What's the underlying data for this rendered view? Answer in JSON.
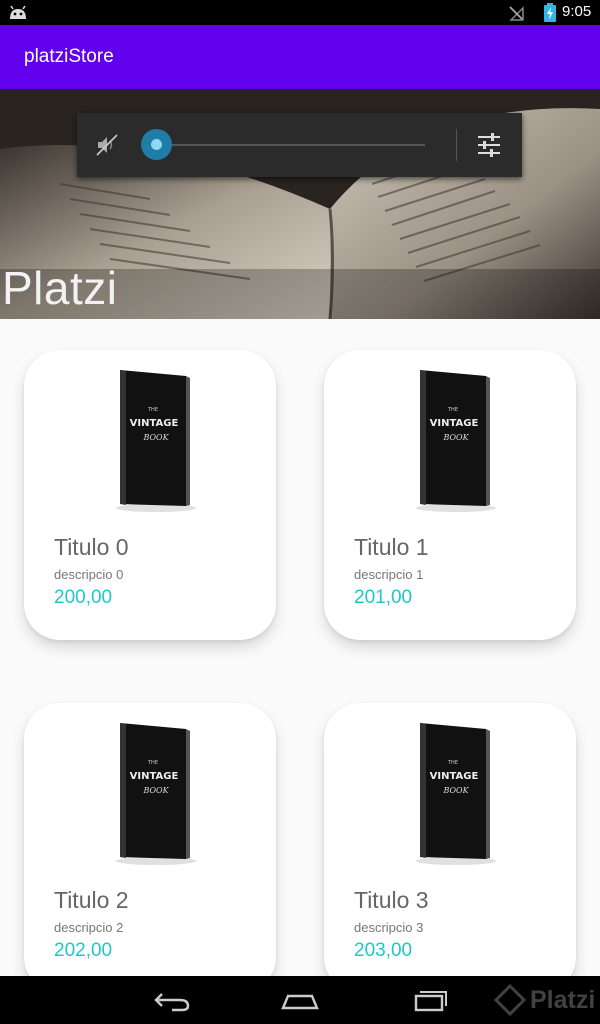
{
  "status_bar": {
    "time": "9:05",
    "icons": [
      "android-icon",
      "signal-off-icon",
      "battery-charging-icon"
    ]
  },
  "app_bar": {
    "title": "platziStore"
  },
  "hero": {
    "brand_text": "Platzi"
  },
  "volume_panel": {
    "level": 0.0,
    "icons": [
      "volume-mute-icon",
      "equalizer-settings-icon"
    ],
    "accent_color": "#33b5e5"
  },
  "products": [
    {
      "title": "Titulo 0",
      "description": "descripcio 0",
      "price": "200,00"
    },
    {
      "title": "Titulo 1",
      "description": "descripcio 1",
      "price": "201,00"
    },
    {
      "title": "Titulo 2",
      "description": "descripcio 2",
      "price": "202,00"
    },
    {
      "title": "Titulo 3",
      "description": "descripcio 3",
      "price": "203,00"
    }
  ],
  "book_cover": {
    "line1": "THE",
    "line2": "VINTAGE",
    "line3": "BOOK"
  },
  "nav_bar": {
    "icons": [
      "back-icon",
      "home-icon",
      "recents-icon"
    ],
    "watermark": "Platzi"
  },
  "colors": {
    "app_bar": "#6200ee",
    "price": "#1ec8c8",
    "title_text": "#666666"
  }
}
